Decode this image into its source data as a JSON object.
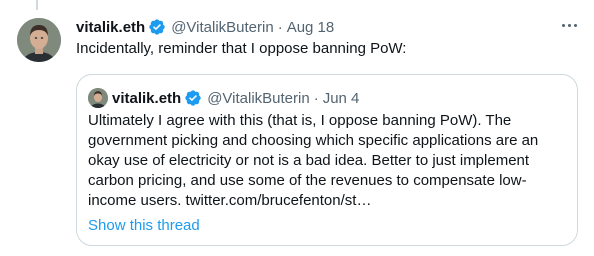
{
  "tweet": {
    "name": "vitalik.eth",
    "handle": "@VitalikButerin",
    "separator": "·",
    "date": "Aug 18",
    "text": "Incidentally, reminder that I oppose banning PoW:"
  },
  "quoted": {
    "name": "vitalik.eth",
    "handle": "@VitalikButerin",
    "separator": "·",
    "date": "Jun 4",
    "text": "Ultimately I agree with this (that is, I oppose banning PoW). The government picking and choosing which specific applications are an okay use of electricity or not is a bad idea. Better to just implement carbon pricing, and use some of the revenues to compensate low-income users. twitter.com/brucefenton/st…",
    "show_thread": "Show this thread"
  },
  "icons": {
    "verified": "verified-badge-icon",
    "more": "more-options-icon"
  },
  "colors": {
    "accent": "#1d9bf0",
    "secondary_text": "#536471",
    "border": "#cfd9de"
  }
}
